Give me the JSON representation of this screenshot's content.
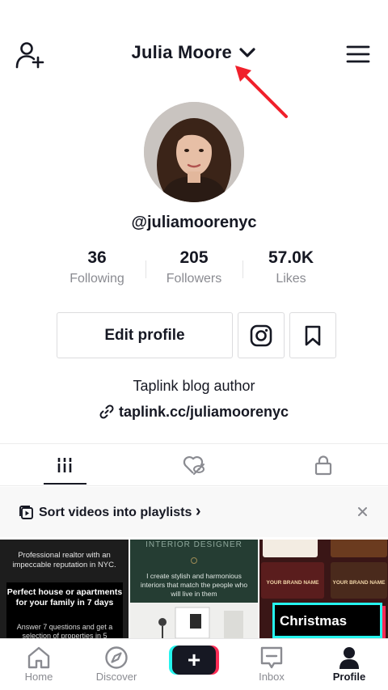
{
  "header": {
    "title": "Julia Moore",
    "add_user_icon": "person-plus-icon",
    "menu_icon": "hamburger-menu-icon",
    "dropdown_icon": "chevron-down-icon",
    "annotation_color": "#fe2c55"
  },
  "profile": {
    "username": "@juliamoorenyc",
    "stats": [
      {
        "value": "36",
        "label": "Following"
      },
      {
        "value": "205",
        "label": "Followers"
      },
      {
        "value": "57.0K",
        "label": "Likes"
      }
    ],
    "edit_label": "Edit profile",
    "instagram_icon": "instagram-icon",
    "bookmark_icon": "bookmark-icon",
    "bio": "Taplink blog author",
    "link": "taplink.cc/juliamoorenyc",
    "link_icon": "link-icon"
  },
  "tabs": [
    {
      "icon": "grid-icon",
      "active": true
    },
    {
      "icon": "liked-heart-hidden-icon",
      "active": false
    },
    {
      "icon": "lock-icon",
      "active": false
    }
  ],
  "playlist": {
    "label": "Sort videos into playlists",
    "chevron": "›",
    "close": "×"
  },
  "videos": [
    {
      "top_text": "Professional realtor with an impeccable reputation in NYC.",
      "headline": "Perfect house or apartments for your family in 7 days",
      "body": "Answer 7 questions and get a selection of properties in 5"
    },
    {
      "caption": "INTERIOR DESIGNER",
      "text": "I create stylish and harmonious interiors that match the people who will live in them"
    },
    {
      "card1": "YOUR BRAND NAME",
      "card2": "YOUR BRAND NAME",
      "overlay": "Christmas"
    }
  ],
  "nav": {
    "home": "Home",
    "discover": "Discover",
    "create": "+",
    "inbox": "Inbox",
    "profile": "Profile",
    "active": "Profile",
    "accent_cyan": "#25f4ee",
    "accent_red": "#fe2c55"
  }
}
